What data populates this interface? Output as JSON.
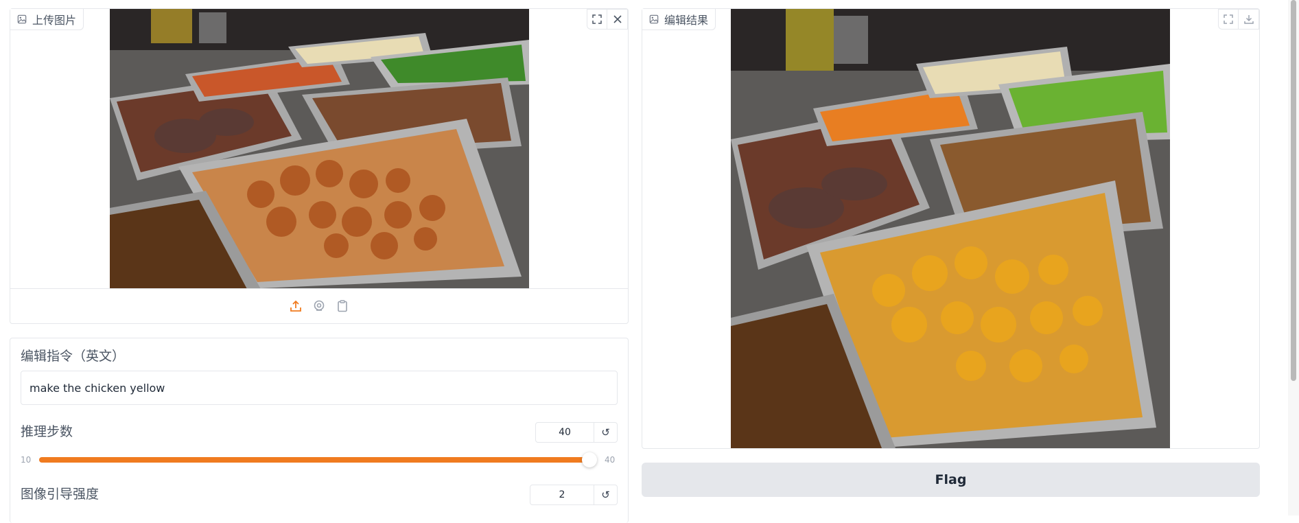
{
  "upload": {
    "label": "上传图片",
    "label_icon": "image-icon",
    "expand_icon": "fullscreen-icon",
    "close_icon": "close-icon",
    "sources": [
      "upload-icon",
      "webcam-icon",
      "clipboard-icon"
    ],
    "accent": "#f07b1f"
  },
  "result": {
    "label": "编辑结果",
    "label_icon": "image-icon",
    "expand_icon": "fullscreen-icon",
    "download_icon": "download-icon"
  },
  "instruction": {
    "label": "编辑指令（英文）",
    "value": "make the chicken yellow"
  },
  "steps": {
    "label": "推理步数",
    "value": "40",
    "min": "10",
    "max": "40",
    "fraction": 1.0,
    "reset_icon": "↺"
  },
  "guidance": {
    "label": "图像引导强度",
    "value": "2",
    "reset_icon": "↺"
  },
  "flag": {
    "label": "Flag"
  },
  "colors": {
    "accent": "#f07b1f",
    "button_bg": "#e5e7eb"
  }
}
